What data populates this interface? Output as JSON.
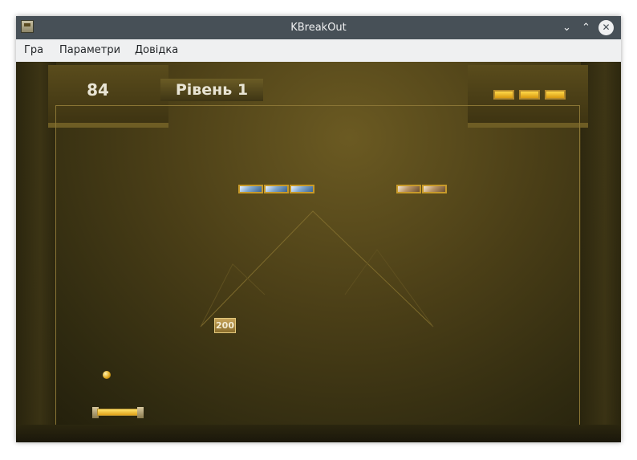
{
  "window": {
    "title": "KBreakOut",
    "minimize_glyph": "⌄",
    "maximize_glyph": "⌃",
    "close_glyph": "✕"
  },
  "menu": {
    "items": [
      "Гра",
      "Параметри",
      "Довідка"
    ]
  },
  "game": {
    "score": "84",
    "level": "Рівень 1",
    "lives": 3,
    "bonus_label": "200",
    "bricks": {
      "left_group": {
        "type": "blue",
        "count": 3
      },
      "right_group": {
        "type": "brown",
        "count": 2
      }
    }
  },
  "colors": {
    "titlebar": "#475057",
    "menubar": "#eff0f1",
    "brick_border": "#c79a2a",
    "paddle": "#ffd94a"
  }
}
